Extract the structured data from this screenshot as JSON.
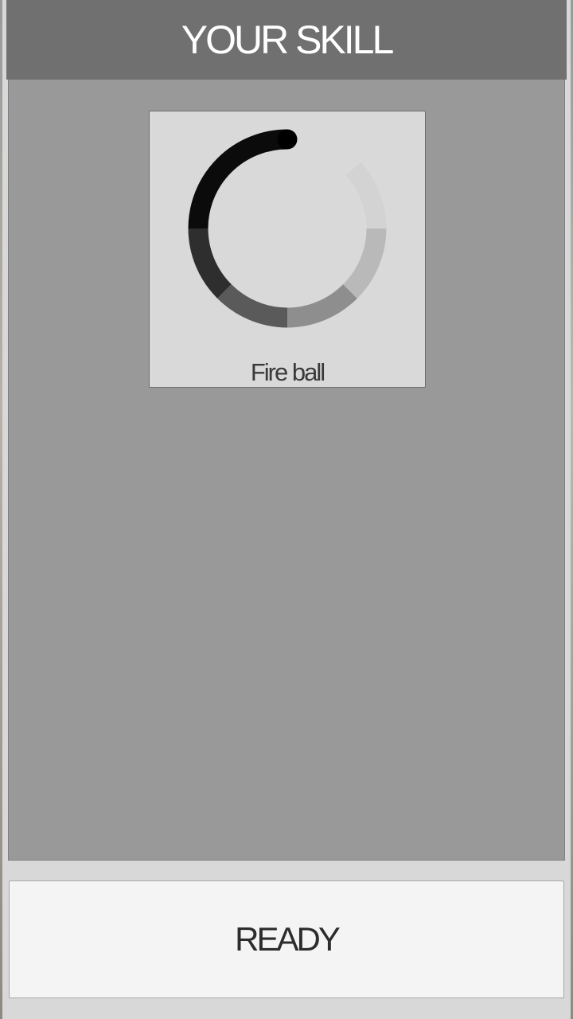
{
  "header": {
    "title": "YOUR SKILL"
  },
  "skills": [
    {
      "name": "Fire ball",
      "icon": "loading-ring-icon"
    }
  ],
  "actions": {
    "ready_label": "READY"
  },
  "colors": {
    "header_bg": "#707070",
    "panel_bg": "#999999",
    "card_bg": "#d9d9d9",
    "button_bg": "#f4f4f4"
  }
}
